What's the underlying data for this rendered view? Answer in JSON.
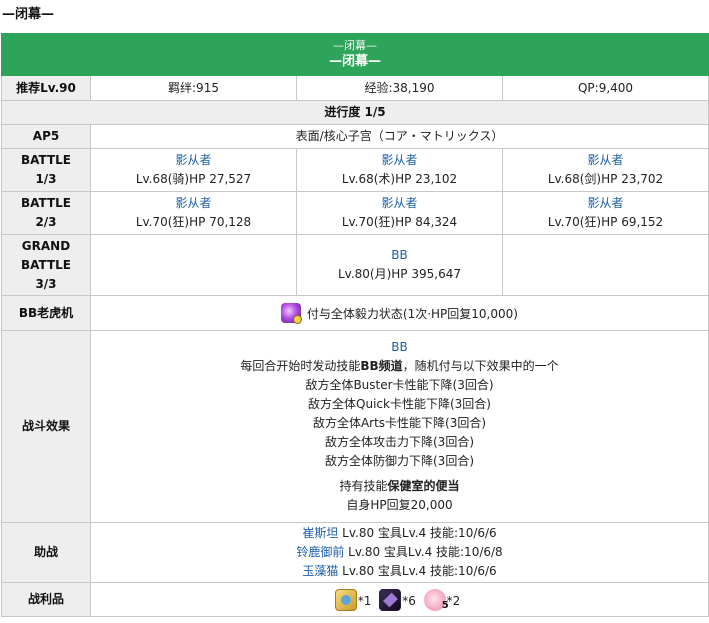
{
  "page_heading": "—闭幕—",
  "header": {
    "small": "—闭幕—",
    "big": "—闭幕—"
  },
  "info": {
    "level_label": "推荐Lv.90",
    "bond": "羁绊:915",
    "exp": "经验:38,190",
    "qp": "QP:9,400"
  },
  "progress": "进行度 1/5",
  "ap": {
    "label": "AP5",
    "location": "表面/核心子宫（コア・マトリックス）"
  },
  "battles": [
    {
      "label_lines": [
        "BATTLE",
        "1/3"
      ],
      "enemies": [
        {
          "name": "影从者",
          "stats": "Lv.68(骑)HP 27,527"
        },
        {
          "name": "影从者",
          "stats": "Lv.68(术)HP 23,102"
        },
        {
          "name": "影从者",
          "stats": "Lv.68(剑)HP 23,702"
        }
      ]
    },
    {
      "label_lines": [
        "BATTLE",
        "2/3"
      ],
      "enemies": [
        {
          "name": "影从者",
          "stats": "Lv.70(狂)HP 70,128"
        },
        {
          "name": "影从者",
          "stats": "Lv.70(狂)HP 84,324"
        },
        {
          "name": "影从者",
          "stats": "Lv.70(狂)HP 69,152"
        }
      ]
    }
  ],
  "grand_battle": {
    "label_lines": [
      "GRAND",
      "BATTLE",
      "3/3"
    ],
    "boss_name": "BB",
    "boss_stats": "Lv.80(月)HP 395,647"
  },
  "bb_slot": {
    "label": "BB老虎机",
    "icon": "bb-buff-icon",
    "text": "付与全体毅力状态(1次·HP回复10,000)"
  },
  "battle_effects": {
    "label": "战斗效果",
    "name": "BB",
    "skill_intro_pre": "每回合开始时发动技能",
    "skill_intro_name": "BB频道",
    "skill_intro_post": "，随机付与以下效果中的一个",
    "effects": [
      "敌方全体Buster卡性能下降(3回合)",
      "敌方全体Quick卡性能下降(3回合)",
      "敌方全体Arts卡性能下降(3回合)",
      "敌方全体攻击力下降(3回合)",
      "敌方全体防御力下降(3回合)"
    ],
    "skill2_pre": "持有技能",
    "skill2_name": "保健室的便当",
    "skill2_effect": "自身HP回复20,000"
  },
  "support": {
    "label": "助战",
    "entries": [
      {
        "name": "崔斯坦",
        "detail": " Lv.80 宝具Lv.4 技能:10/6/6"
      },
      {
        "name": "铃鹿御前",
        "detail": " Lv.80 宝具Lv.4 技能:10/6/8"
      },
      {
        "name": "玉藻猫",
        "detail": " Lv.80 宝具Lv.4 技能:10/6/6"
      }
    ]
  },
  "drops": {
    "label": "战利品",
    "items": [
      {
        "icon": "gold-gem-icon",
        "count": "*1"
      },
      {
        "icon": "dark-crystal-icon",
        "count": "*6"
      },
      {
        "icon": "pink-orb-icon",
        "badge": "5",
        "count": "*2"
      }
    ]
  },
  "colors": {
    "header_green": "#2ea35a",
    "link_blue": "#1d5fa8",
    "label_bg": "#eeeeee"
  }
}
